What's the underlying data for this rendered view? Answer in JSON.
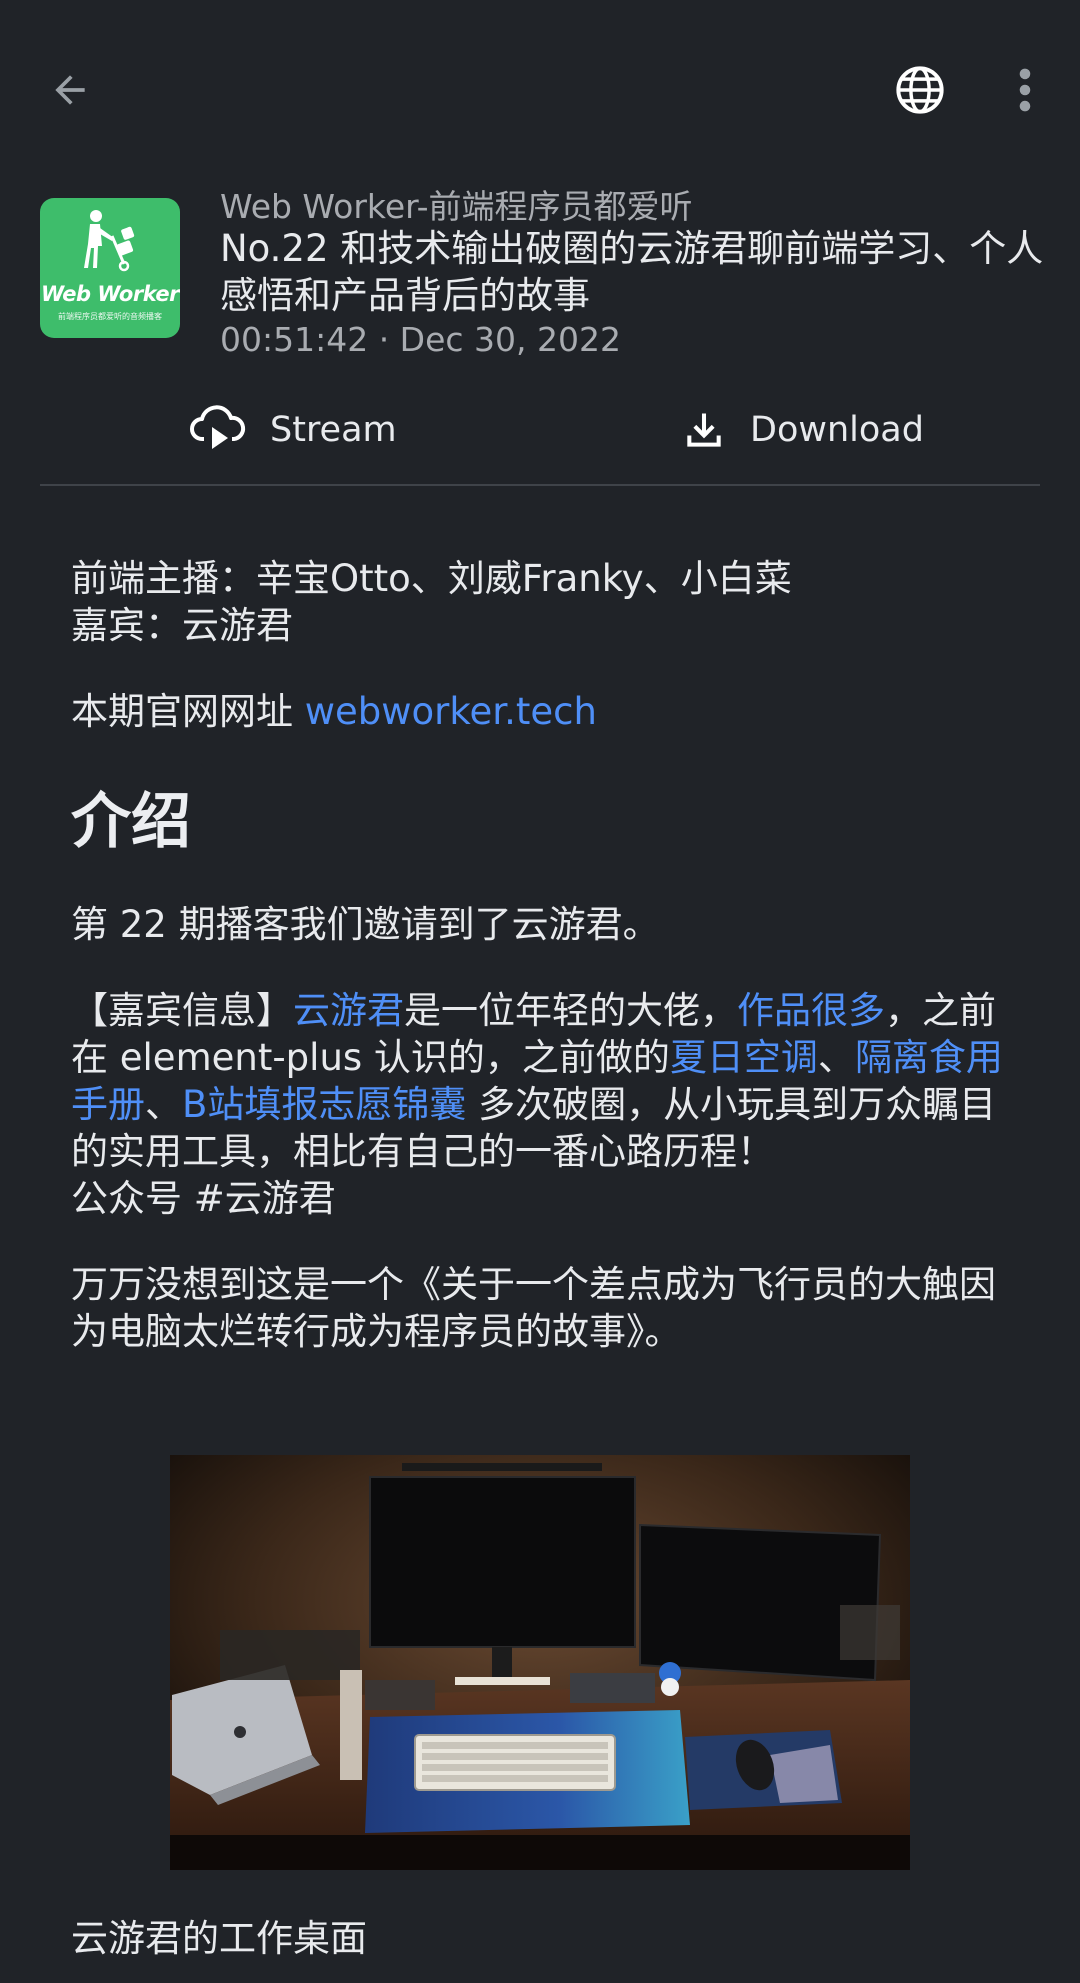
{
  "topbar": {
    "back_icon": "arrow-left-icon",
    "globe_icon": "globe-icon",
    "more_icon": "more-vertical-icon"
  },
  "podcast": {
    "logo_text": "Web Worker",
    "logo_sub": "前端程序员都爱听的音频播客",
    "name": "Web Worker-前端程序员都爱听"
  },
  "episode": {
    "title": "No.22 和技术输出破圈的云游君聊前端学习、个人感悟和产品背后的故事",
    "meta": "00:51:42 · Dec 30, 2022"
  },
  "actions": {
    "stream_label": "Stream",
    "stream_icon": "cloud-play-icon",
    "download_label": "Download",
    "download_icon": "download-icon"
  },
  "notes": {
    "hosts": "前端主播：辛宝Otto、刘威Franky、小白菜",
    "guest": "嘉宾：云游君",
    "site_prefix": "本期官网网址 ",
    "site_link": "webworker.tech",
    "intro_heading": "介绍",
    "intro_p1": "第 22 期播客我们邀请到了云游君。",
    "guest_info": {
      "t1": "【嘉宾信息】",
      "link1": "云游君",
      "t2": "是一位年轻的大佬，",
      "link2": "作品很多",
      "t3": "，之前在 element-plus 认识的，之前做的",
      "link3": "夏日空调",
      "t4": "、",
      "link4": "隔离食用手册",
      "t5": "、",
      "link5": "B站填报志愿锦囊",
      "t6": " 多次破圈，从小玩具到万众瞩目的实用工具，相比有自己的一番心路历程！"
    },
    "wechat": "公众号 #云游君",
    "story": "万万没想到这是一个《关于一个差点成为飞行员的大触因为电脑太烂转行成为程序员的故事》。",
    "photo_caption": "云游君的工作桌面"
  },
  "colors": {
    "background": "#202328",
    "link": "#4f8ff7",
    "logo_green": "#3ebd6b",
    "secondary_text": "#a9acb1"
  }
}
